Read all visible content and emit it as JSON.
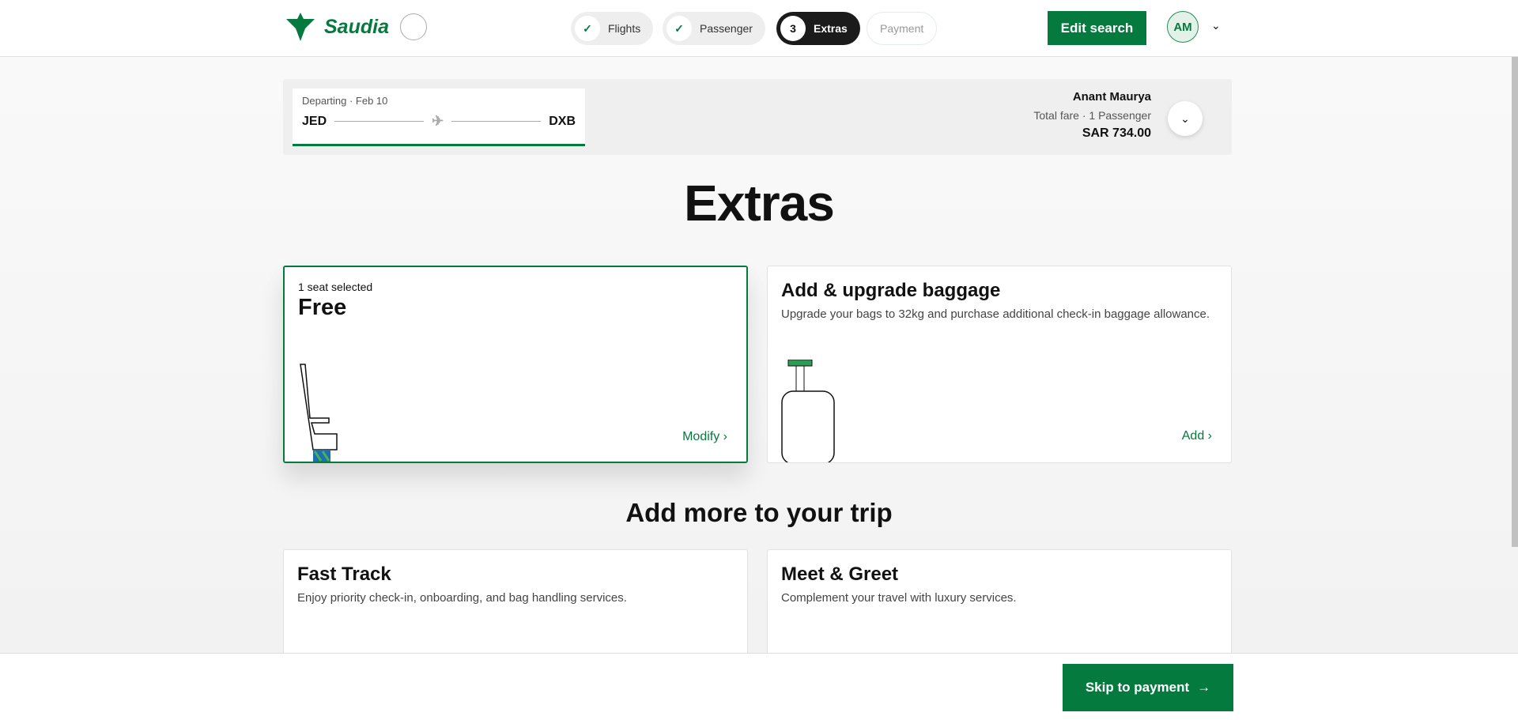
{
  "header": {
    "brand": "Saudia",
    "steps": [
      {
        "label": "Flights",
        "status": "done"
      },
      {
        "label": "Passenger",
        "status": "done"
      },
      {
        "number": "3",
        "label": "Extras",
        "status": "active"
      },
      {
        "label": "Payment",
        "status": "pending"
      }
    ],
    "edit_search": "Edit search",
    "avatar": "AM"
  },
  "summary": {
    "departing": "Departing · Feb 10",
    "from": "JED",
    "to": "DXB",
    "name": "Anant Maurya",
    "fare_label": "Total fare · 1 Passenger",
    "price": "SAR 734.00"
  },
  "title": "Extras",
  "cards": [
    {
      "small": "1 seat selected",
      "big": "Free",
      "action": "Modify"
    },
    {
      "title": "Add & upgrade baggage",
      "desc": "Upgrade your bags to 32kg and purchase additional check-in baggage allowance.",
      "action": "Add"
    }
  ],
  "more_title": "Add more to your trip",
  "more": [
    {
      "title": "Fast Track",
      "desc": "Enjoy priority check-in, onboarding, and bag handling services."
    },
    {
      "title": "Meet & Greet",
      "desc": "Complement your travel with luxury services."
    }
  ],
  "footer": {
    "skip": "Skip to payment"
  },
  "colors": {
    "brand": "#047a3e"
  }
}
